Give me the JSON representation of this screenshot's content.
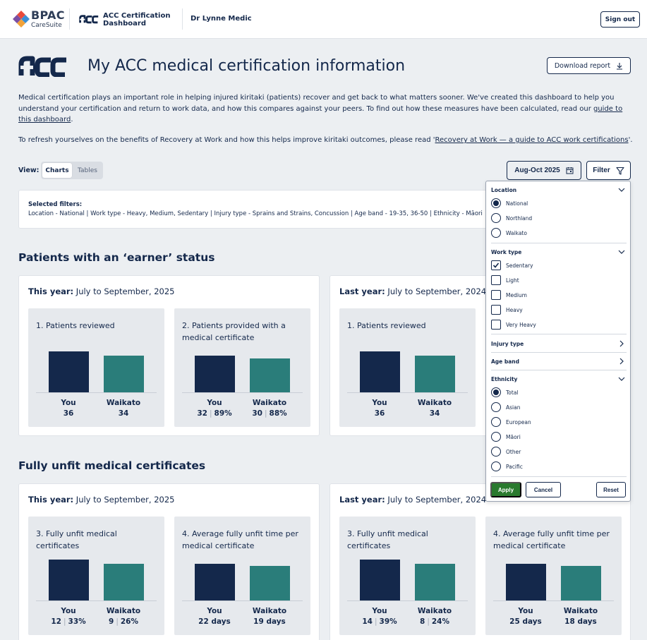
{
  "topbar": {
    "brand": "BPAC",
    "brand_sub": "CareSuite",
    "app_title_line1": "ACC Certification",
    "app_title_line2": "Dashboard",
    "user": "Dr Lynne Medic",
    "signout": "Sign out"
  },
  "header": {
    "title": "My ACC medical certification information",
    "download": "Download report"
  },
  "intro": {
    "p1_a": "Medical certification plays an important role in helping injured kiritaki (patients) recover and get back to what matters sooner.  We've created this dashboard to help you understand your certification and return to work data, and how this compares against your peers. To find out how these measures have been calculated, read our ",
    "p1_link": "guide to this dashboard",
    "p1_end": ".",
    "p2_a": "To refresh yourselves on the benefits of Recovery at Work and how this helps improve kiritaki outcomes,  please read '",
    "p2_link": "Recovery at Work — a guide to ACC work certifications",
    "p2_end": "'."
  },
  "view": {
    "label": "View:",
    "charts": "Charts",
    "tables": "Tables"
  },
  "date_range": "Aug-Oct 2025",
  "filter_label": "Filter",
  "selected_filters": {
    "title": "Selected filters:",
    "text": "Location - National  |  Work type - Heavy, Medium, Sedentary  |  Injury type - Sprains and Strains, Concussion  |  Age band - 19-35, 36-50  |  Ethnicity - Māori"
  },
  "sections": [
    {
      "title": "Patients with an ‘earner’ status",
      "this_year": {
        "label": "This year:",
        "period": " July to September, 2025",
        "tiles": [
          {
            "title": "1. Patients reviewed",
            "you_label": "You",
            "you_value": "36",
            "region_label": "Waikato",
            "region_value": "34",
            "you_ratio": 1.0,
            "region_ratio": 0.9
          },
          {
            "title": "2. Patients provided with a medical certificate",
            "you_label": "You",
            "you_value": "32",
            "you_pct": "89%",
            "region_label": "Waikato",
            "region_value": "30",
            "region_pct": "88%",
            "you_ratio": 1.0,
            "region_ratio": 0.92
          }
        ]
      },
      "last_year": {
        "label": "Last year:",
        "period": " July to September, 2024",
        "tiles": [
          {
            "title": "1. Patients reviewed",
            "you_label": "You",
            "you_value": "36",
            "region_label": "Waikato",
            "region_value": "34",
            "you_ratio": 1.0,
            "region_ratio": 0.9
          }
        ]
      }
    },
    {
      "title": "Fully unfit medical certificates",
      "this_year": {
        "label": "This year:",
        "period": " July to September, 2025",
        "tiles": [
          {
            "title": "3. Fully unfit medical certificates",
            "you_label": "You",
            "you_value": "12",
            "you_pct": "33%",
            "region_label": "Waikato",
            "region_value": "9",
            "region_pct": "26%",
            "you_ratio": 1.0,
            "region_ratio": 0.9
          },
          {
            "title": "4. Average fully unfit time per medical certificate",
            "you_label": "You",
            "you_value": "22 days",
            "region_label": "Waikato",
            "region_value": "19 days",
            "you_ratio": 1.0,
            "region_ratio": 0.94
          }
        ]
      },
      "last_year": {
        "label": "Last year:",
        "period": " July to September, 2024",
        "tiles": [
          {
            "title": "3. Fully unfit medical certificates",
            "you_label": "You",
            "you_value": "14",
            "you_pct": "39%",
            "region_label": "Waikato",
            "region_value": "8",
            "region_pct": "24%",
            "you_ratio": 1.0,
            "region_ratio": 0.9
          },
          {
            "title": "4. Average fully unfit  time per medical certificate",
            "you_label": "You",
            "you_value": "25 days",
            "region_label": "Waikato",
            "region_value": "18 days",
            "you_ratio": 1.0,
            "region_ratio": 0.94
          }
        ]
      }
    }
  ],
  "filter_panel": {
    "location": {
      "label": "Location",
      "options": [
        "National",
        "Northland",
        "Waikato"
      ],
      "selected": "National"
    },
    "work_type": {
      "label": "Work type",
      "options": [
        "Sedentary",
        "Light",
        "Medium",
        "Heavy",
        "Very Heavy"
      ],
      "checked": [
        "Sedentary"
      ]
    },
    "injury_type": {
      "label": "Injury type"
    },
    "age_band": {
      "label": "Age band"
    },
    "ethnicity": {
      "label": "Ethnicity",
      "options": [
        "Total",
        "Asian",
        "European",
        "Māori",
        "Other",
        "Pacific"
      ],
      "selected": "Total"
    },
    "apply": "Apply",
    "cancel": "Cancel",
    "reset": "Reset"
  },
  "colors": {
    "navy": "#14284b",
    "teal": "#2a7d7a",
    "apply_green": "#2a7a2e",
    "background": "#eceff2"
  }
}
